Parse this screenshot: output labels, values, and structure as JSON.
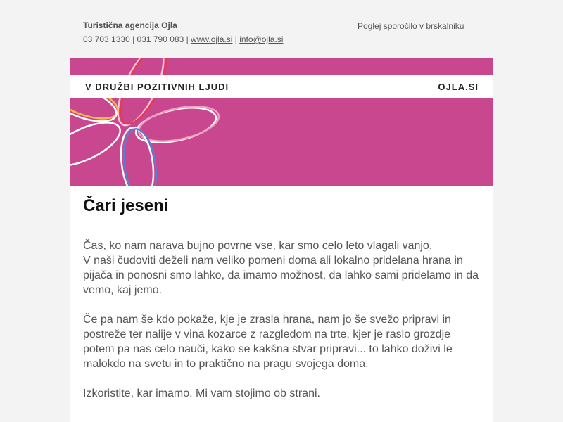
{
  "header": {
    "company": "Turistična agencija Ojla",
    "phones": "03 703 1330 | 031 790 083 |",
    "website": "www.ojla.si",
    "separator": "|",
    "email": "info@ojla.si",
    "view_in_browser": "Poglej sporočilo v brskalniku"
  },
  "banner": {
    "tagline": "V DRUŽBI POZITIVNIH LJUDI",
    "site": "OJLA.SI",
    "background_color": "#c9478e"
  },
  "article": {
    "title": "Čari jeseni",
    "paragraph1_line1": "Čas, ko nam narava bujno povrne vse, kar smo celo leto vlagali vanjo.",
    "paragraph1_line2": "V naši čudoviti deželi nam veliko pomeni doma ali lokalno pridelana hrana in pijača in ponosni smo lahko, da imamo možnost, da lahko sami pridelamo in da vemo, kaj jemo.",
    "paragraph2": "Če pa nam še kdo pokaže, kje je zrasla hrana, nam jo še svežo pripravi in postreže ter nalije v vina kozarce z razgledom na trte, kjer je raslo grozdje potem pa nas celo nauči, kako se kakšna stvar pripravi... to lahko doživi le malokdo na svetu in to praktično na pragu svojega doma.",
    "paragraph3": "Izkoristite, kar imamo. Mi vam stojimo ob strani."
  }
}
